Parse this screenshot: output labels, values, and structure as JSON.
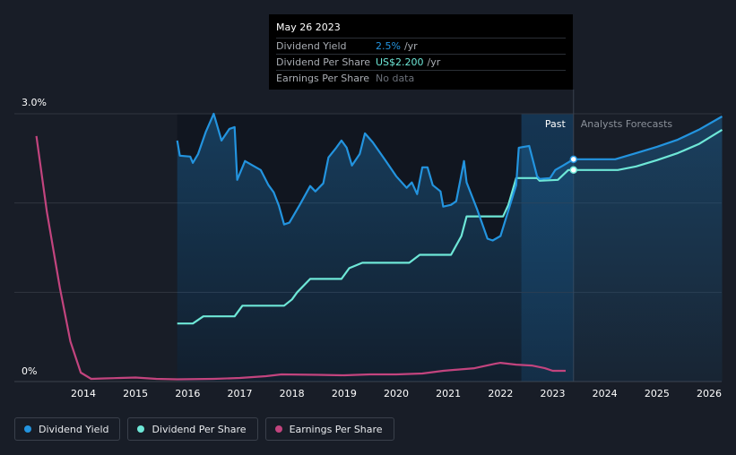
{
  "tooltip": {
    "date": "May 26 2023",
    "rows": [
      {
        "name": "Dividend Yield",
        "value": "2.5%",
        "unit": "/yr"
      },
      {
        "name": "Dividend Per Share",
        "value": "US$2.200",
        "unit": "/yr"
      },
      {
        "name": "Earnings Per Share",
        "value": "No data"
      }
    ]
  },
  "colors": {
    "background": "#181d27",
    "dividend_yield": "#2394df",
    "dividend_per_share": "#6ee7d7",
    "earnings_per_share": "#c2447e"
  },
  "legend": [
    {
      "label": "Dividend Yield",
      "color": "#2394df"
    },
    {
      "label": "Dividend Per Share",
      "color": "#6ee7d7"
    },
    {
      "label": "Earnings Per Share",
      "color": "#c2447e"
    }
  ],
  "chart_data": {
    "type": "line",
    "title": "",
    "xlabel": "",
    "ylabel": "",
    "y_tick_labels": [
      "3.0%",
      "0%"
    ],
    "xlim": [
      2013.0,
      2026.3
    ],
    "ylim": [
      0,
      3.0
    ],
    "x_ticks": [
      2014,
      2015,
      2016,
      2017,
      2018,
      2019,
      2020,
      2021,
      2022,
      2023,
      2024,
      2025,
      2026
    ],
    "grid": true,
    "legend_position": "bottom-left",
    "regions": {
      "past_label": "Past",
      "forecast_label": "Analysts Forecasts",
      "past_range": [
        2022.4,
        2023.4
      ],
      "current_date": 2023.4
    },
    "series": [
      {
        "name": "Dividend Yield",
        "unit": "%",
        "points": [
          [
            2015.8,
            2.7
          ],
          [
            2015.85,
            2.53
          ],
          [
            2016.05,
            2.52
          ],
          [
            2016.1,
            2.45
          ],
          [
            2016.2,
            2.55
          ],
          [
            2016.35,
            2.8
          ],
          [
            2016.5,
            3.0
          ],
          [
            2016.65,
            2.7
          ],
          [
            2016.8,
            2.83
          ],
          [
            2016.9,
            2.85
          ],
          [
            2016.95,
            2.26
          ],
          [
            2017.1,
            2.47
          ],
          [
            2017.25,
            2.42
          ],
          [
            2017.4,
            2.37
          ],
          [
            2017.55,
            2.2
          ],
          [
            2017.65,
            2.12
          ],
          [
            2017.75,
            1.97
          ],
          [
            2017.85,
            1.76
          ],
          [
            2017.95,
            1.78
          ],
          [
            2018.15,
            1.98
          ],
          [
            2018.35,
            2.19
          ],
          [
            2018.45,
            2.13
          ],
          [
            2018.6,
            2.22
          ],
          [
            2018.7,
            2.51
          ],
          [
            2018.85,
            2.62
          ],
          [
            2018.95,
            2.7
          ],
          [
            2019.05,
            2.62
          ],
          [
            2019.15,
            2.42
          ],
          [
            2019.3,
            2.55
          ],
          [
            2019.4,
            2.78
          ],
          [
            2019.55,
            2.68
          ],
          [
            2019.8,
            2.47
          ],
          [
            2020.0,
            2.3
          ],
          [
            2020.2,
            2.17
          ],
          [
            2020.3,
            2.23
          ],
          [
            2020.4,
            2.1
          ],
          [
            2020.5,
            2.4
          ],
          [
            2020.6,
            2.4
          ],
          [
            2020.7,
            2.2
          ],
          [
            2020.85,
            2.13
          ],
          [
            2020.9,
            1.96
          ],
          [
            2021.05,
            1.98
          ],
          [
            2021.15,
            2.02
          ],
          [
            2021.3,
            2.47
          ],
          [
            2021.35,
            2.23
          ],
          [
            2021.55,
            1.93
          ],
          [
            2021.75,
            1.6
          ],
          [
            2021.85,
            1.58
          ],
          [
            2022.0,
            1.63
          ],
          [
            2022.3,
            2.2
          ],
          [
            2022.35,
            2.62
          ],
          [
            2022.45,
            2.63
          ],
          [
            2022.55,
            2.64
          ],
          [
            2022.7,
            2.3
          ],
          [
            2022.75,
            2.27
          ],
          [
            2022.95,
            2.28
          ],
          [
            2023.05,
            2.37
          ],
          [
            2023.2,
            2.42
          ],
          [
            2023.4,
            2.49
          ],
          [
            2023.8,
            2.49
          ],
          [
            2024.2,
            2.49
          ],
          [
            2024.6,
            2.56
          ],
          [
            2025.0,
            2.63
          ],
          [
            2025.4,
            2.71
          ],
          [
            2025.8,
            2.82
          ],
          [
            2026.25,
            2.97
          ]
        ]
      },
      {
        "name": "Dividend Per Share",
        "unit": "US$",
        "points": [
          [
            2015.8,
            0.65
          ],
          [
            2016.1,
            0.65
          ],
          [
            2016.3,
            0.73
          ],
          [
            2016.9,
            0.73
          ],
          [
            2017.05,
            0.85
          ],
          [
            2017.85,
            0.85
          ],
          [
            2018.0,
            0.92
          ],
          [
            2018.1,
            1.0
          ],
          [
            2018.35,
            1.15
          ],
          [
            2018.95,
            1.15
          ],
          [
            2019.1,
            1.27
          ],
          [
            2019.35,
            1.33
          ],
          [
            2020.25,
            1.33
          ],
          [
            2020.45,
            1.42
          ],
          [
            2021.05,
            1.42
          ],
          [
            2021.25,
            1.63
          ],
          [
            2021.35,
            1.85
          ],
          [
            2022.05,
            1.85
          ],
          [
            2022.15,
            1.98
          ],
          [
            2022.3,
            2.28
          ],
          [
            2022.7,
            2.28
          ],
          [
            2022.75,
            2.25
          ],
          [
            2023.1,
            2.26
          ],
          [
            2023.3,
            2.37
          ],
          [
            2023.4,
            2.37
          ],
          [
            2024.25,
            2.37
          ],
          [
            2024.6,
            2.41
          ],
          [
            2025.0,
            2.48
          ],
          [
            2025.4,
            2.56
          ],
          [
            2025.8,
            2.66
          ],
          [
            2026.25,
            2.82
          ]
        ]
      },
      {
        "name": "Earnings Per Share",
        "unit": "",
        "points": [
          [
            2013.1,
            2.75
          ],
          [
            2013.3,
            1.9
          ],
          [
            2013.55,
            1.05
          ],
          [
            2013.75,
            0.45
          ],
          [
            2013.95,
            0.1
          ],
          [
            2014.15,
            0.03
          ],
          [
            2014.4,
            0.035
          ],
          [
            2014.7,
            0.04
          ],
          [
            2015.0,
            0.045
          ],
          [
            2015.4,
            0.03
          ],
          [
            2015.8,
            0.025
          ],
          [
            2016.5,
            0.03
          ],
          [
            2017.0,
            0.04
          ],
          [
            2017.5,
            0.06
          ],
          [
            2017.8,
            0.08
          ],
          [
            2018.5,
            0.075
          ],
          [
            2019.0,
            0.07
          ],
          [
            2019.5,
            0.08
          ],
          [
            2020.0,
            0.08
          ],
          [
            2020.5,
            0.09
          ],
          [
            2020.9,
            0.12
          ],
          [
            2021.5,
            0.15
          ],
          [
            2021.9,
            0.2
          ],
          [
            2022.0,
            0.21
          ],
          [
            2022.3,
            0.19
          ],
          [
            2022.6,
            0.18
          ],
          [
            2022.85,
            0.15
          ],
          [
            2023.0,
            0.12
          ],
          [
            2023.25,
            0.12
          ]
        ]
      }
    ]
  }
}
